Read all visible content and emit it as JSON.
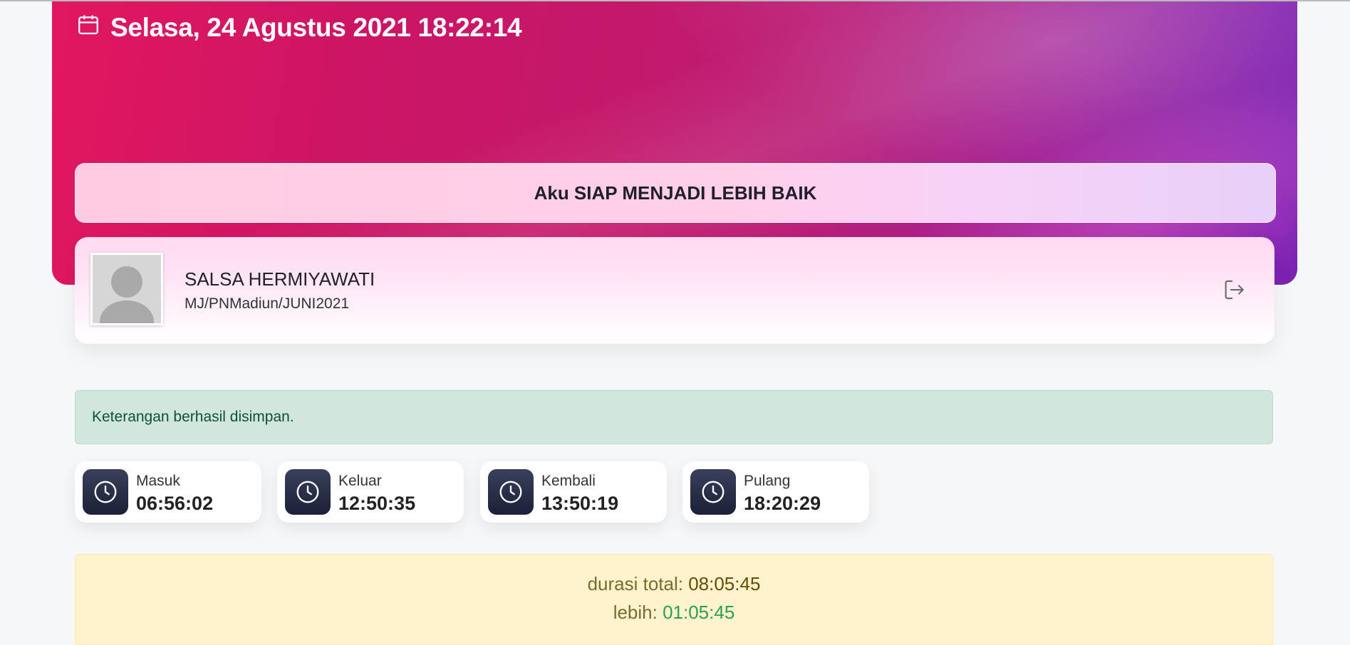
{
  "header": {
    "datetime": "Selasa, 24 Agustus 2021 18:22:14",
    "calendar_icon": "calendar-icon"
  },
  "motto": "Aku SIAP MENJADI LEBIH BAIK",
  "profile": {
    "name": "SALSA HERMIYAWATI",
    "id": "MJ/PNMadiun/JUNI2021",
    "avatar_icon": "user-avatar",
    "logout_icon": "logout-icon"
  },
  "alert_success": "Keterangan berhasil disimpan.",
  "attendance": [
    {
      "label": "Masuk",
      "time": "06:56:02",
      "icon": "clock-icon"
    },
    {
      "label": "Keluar",
      "time": "12:50:35",
      "icon": "clock-icon"
    },
    {
      "label": "Kembali",
      "time": "13:50:19",
      "icon": "clock-icon"
    },
    {
      "label": "Pulang",
      "time": "18:20:29",
      "icon": "clock-icon"
    }
  ],
  "summary": {
    "total_label": "durasi total:",
    "total_value": "08:05:45",
    "extra_label": "lebih:",
    "extra_value": "01:05:45"
  },
  "colors": {
    "hero_start": "#e2175f",
    "hero_end": "#7b22b5",
    "success_bg": "#d1e7dd",
    "warning_bg": "#fff3cd",
    "icon_tile": "#1c2036"
  }
}
